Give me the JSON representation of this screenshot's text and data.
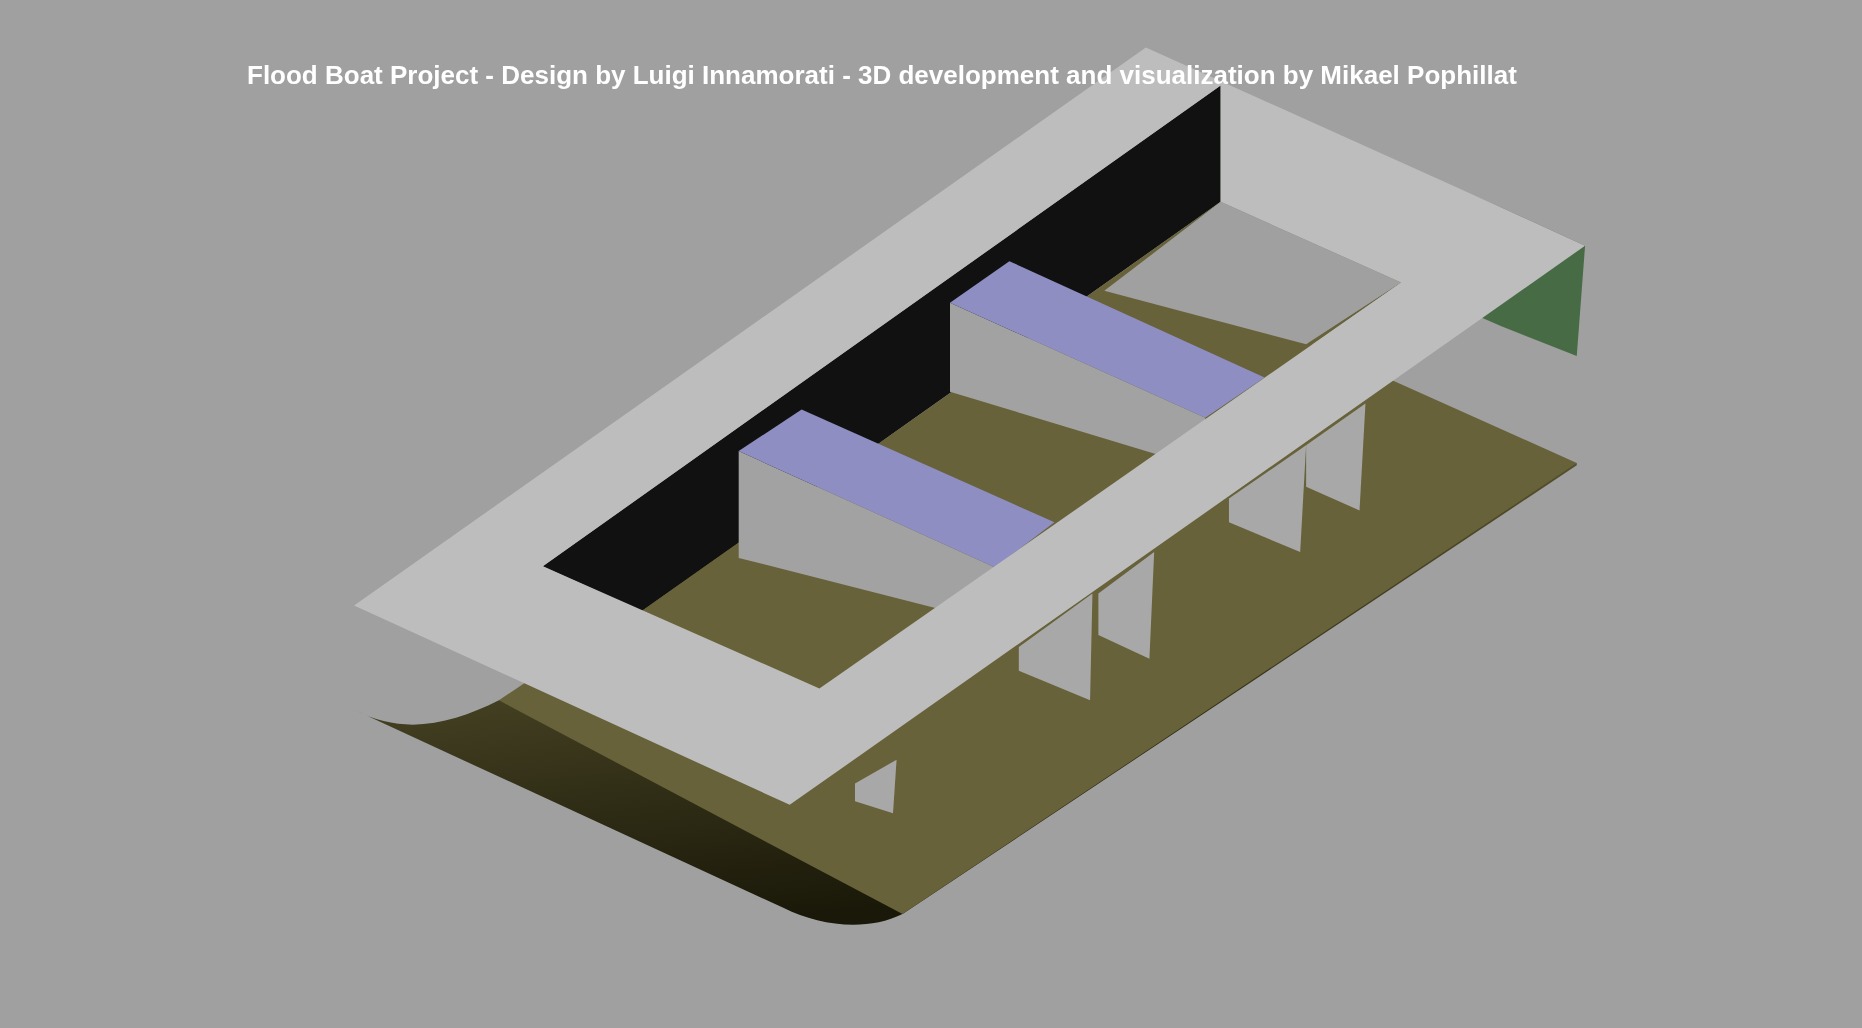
{
  "title": "Flood Boat Project - Design by Luigi Innamorati - 3D development and visualization by Mikael Pophillat"
}
